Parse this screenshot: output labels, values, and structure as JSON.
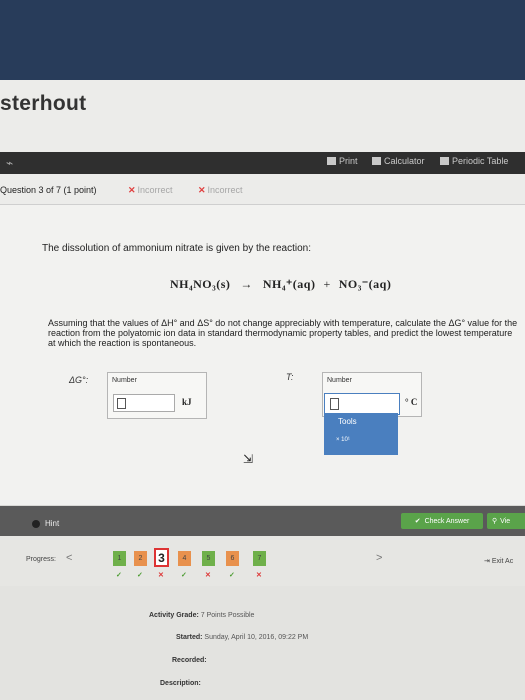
{
  "app": {
    "title": "sterhout"
  },
  "toolbar": {
    "print": "Print",
    "calculator": "Calculator",
    "periodic_table": "Periodic Table"
  },
  "question": {
    "number": "Question 3 of 7 (1 point)",
    "attempts": [
      "Incorrect",
      "Incorrect"
    ],
    "prompt": "The dissolution of ammonium nitrate is given by the reaction:",
    "equation": {
      "reactant": "NH₄NO₃(s)",
      "arrow": "→",
      "product1": "NH₄⁺(aq)",
      "plus": "+",
      "product2": "NO₃⁻(aq)"
    },
    "instructions": "Assuming that the values of ΔH° and ΔS° do not change appreciably with temperature, calculate the ΔG° value for the reaction from the polyatomic ion data in standard thermodynamic property tables, and predict the lowest temperature at which the reaction is spontaneous."
  },
  "answer": {
    "dg_label": "ΔG°:",
    "dg_header": "Number",
    "dg_value": "",
    "dg_unit": "kJ",
    "t_label": "T:",
    "t_header": "Number",
    "t_value": "",
    "t_unit": "° C",
    "tools_label": "Tools",
    "sci_notation": "× 10¹"
  },
  "actions": {
    "hint": "Hint",
    "check_answer": "Check Answer",
    "view": "Vie"
  },
  "progress": {
    "label": "Progress:",
    "prev": "<",
    "next": ">",
    "questions": [
      {
        "num": "1",
        "status": "ok"
      },
      {
        "num": "2",
        "status": "ok"
      },
      {
        "num": "3",
        "status": "bad"
      },
      {
        "num": "4",
        "status": "ok"
      },
      {
        "num": "5",
        "status": "bad"
      },
      {
        "num": "6",
        "status": "ok"
      },
      {
        "num": "7",
        "status": "bad"
      }
    ],
    "exit": "Exit Ac"
  },
  "footer": {
    "grade_label": "Activity Grade:",
    "grade_value": "7 Points Possible",
    "started_label": "Started:",
    "started_value": "Sunday, April 10, 2016, 09:22 PM",
    "recorded_label": "Recorded:",
    "description_label": "Description:"
  },
  "colors": {
    "header_band": "#283c5a",
    "toolbar": "#2f2f2f",
    "accent_green": "#5aa34a",
    "tools_blue": "#4a7fbf",
    "incorrect_red": "#e04040"
  }
}
